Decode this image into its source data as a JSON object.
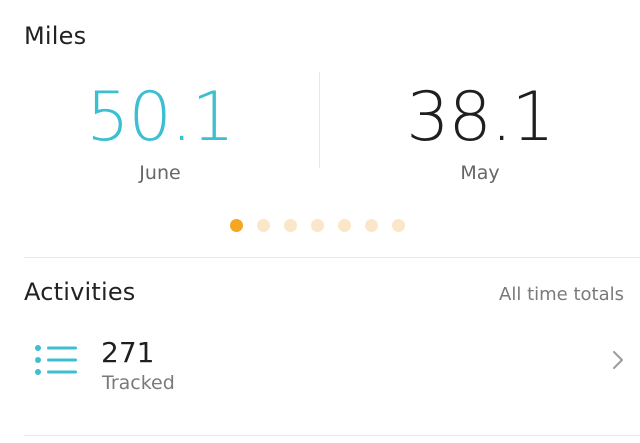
{
  "miles": {
    "title": "Miles",
    "current": {
      "value": "50.1",
      "label": "June"
    },
    "previous": {
      "value": "38.1",
      "label": "May"
    },
    "pager": {
      "total": 7,
      "active_index": 0
    },
    "colors": {
      "accent": "#3cbfd1",
      "dot_active": "#f5a623",
      "dot_inactive": "#fbe7c8"
    }
  },
  "activities": {
    "title": "Activities",
    "link": "All time totals",
    "row": {
      "icon": "list-icon",
      "count": "271",
      "label": "Tracked",
      "trailing_icon": "chevron-right-icon"
    }
  }
}
